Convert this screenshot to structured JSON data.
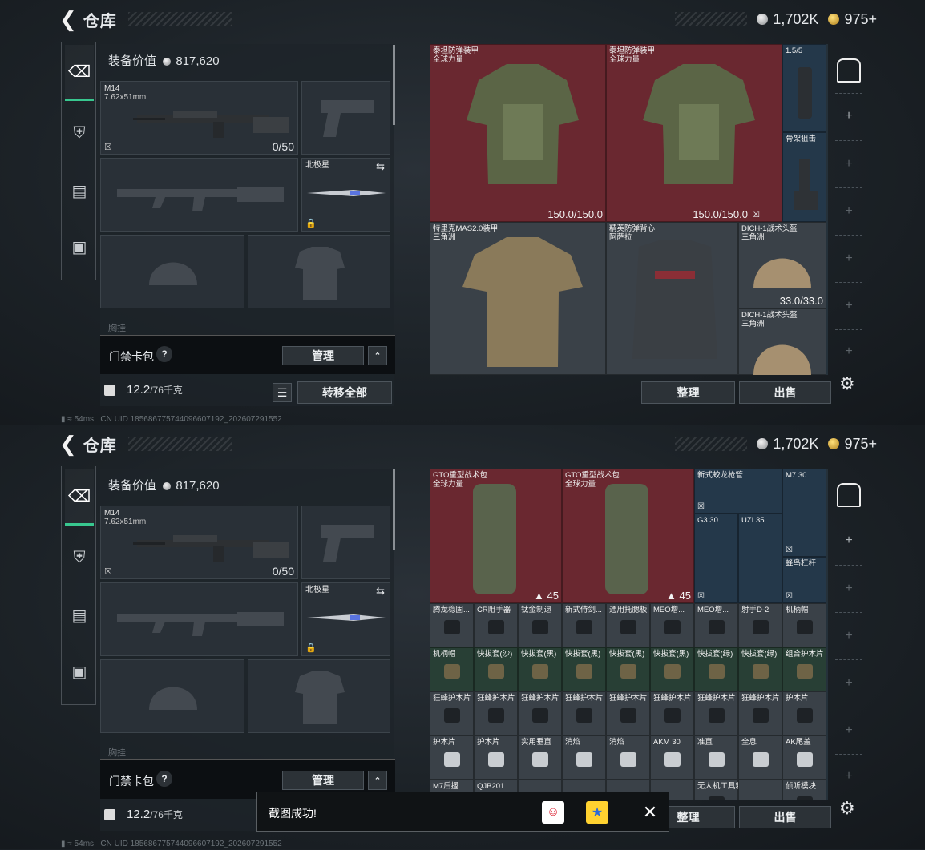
{
  "header": {
    "back_icon": "chevron-left-icon",
    "title": "仓库",
    "silver": "1,702K",
    "gold": "975+"
  },
  "status": {
    "ping": "54ms",
    "uid": "CN UID 185686775744096607192_202607291552"
  },
  "equipment": {
    "value_label": "装备价值",
    "value": "817,620",
    "primary": {
      "name": "M14",
      "caliber": "7.62x51mm",
      "ammo": "0/50"
    },
    "melee": {
      "name": "北极星"
    },
    "chest_label": "胸挂"
  },
  "keycase": {
    "label": "门禁卡包",
    "help": "?",
    "manage": "管理"
  },
  "weight": {
    "current": "12.2",
    "max": "/76千克",
    "transfer_all": "转移全部"
  },
  "actions": {
    "sort": "整理",
    "sell": "出售"
  },
  "stash_top": [
    {
      "name": "泰坦防弹装甲",
      "sub": "全球力量",
      "dur": "150.0/150.0"
    },
    {
      "name": "泰坦防弹装甲",
      "sub": "全球力量",
      "dur": "150.0/150.0"
    },
    {
      "name": "1.5/5",
      "sub": ""
    },
    {
      "name": "骨架狙击",
      "sub": ""
    },
    {
      "name": "特里克MAS2.0装甲",
      "sub": "三角洲"
    },
    {
      "name": "精英防弹背心",
      "sub": "阿萨拉"
    },
    {
      "name": "DICH-1战术头盔",
      "sub": "三角洲",
      "dur": "33.0/33.0"
    },
    {
      "name": "DICH-1战术头盔",
      "sub": "三角洲"
    }
  ],
  "stash_bot": {
    "packs": [
      {
        "name": "GTO重型战术包",
        "sub": "全球力量",
        "count": "45"
      },
      {
        "name": "GTO重型战术包",
        "sub": "全球力量",
        "count": "45"
      }
    ],
    "small": [
      "新式蛟龙枪管",
      "M7 30",
      "G3 30",
      "UZI 35",
      "蜂鸟杠杆"
    ],
    "row1": [
      "腾龙稳固...",
      "CR阻手器",
      "钛金制退",
      "新式侍剑...",
      "通用托腮板",
      "MEO增...",
      "MEO增...",
      "射手D-2",
      "机柄帽"
    ],
    "row2": [
      "机柄帽",
      "快拔套(沙)",
      "快拔套(黑)",
      "快拔套(黑)",
      "快拔套(黑)",
      "快拔套(黑)",
      "快拔套(绿)",
      "快拔套(绿)",
      "组合护木片"
    ],
    "row3": [
      "狂蜂护木片",
      "狂蜂护木片",
      "狂蜂护木片",
      "狂蜂护木片",
      "狂蜂护木片",
      "狂蜂护木片",
      "狂蜂护木片",
      "狂蜂护木片",
      "护木片"
    ],
    "row4": [
      "护木片",
      "护木片",
      "实用垂直",
      "消焰",
      "消焰",
      "AKM 30",
      "准直",
      "全息",
      "AK尾盖"
    ],
    "row5": [
      "M7后握",
      "QJB201",
      "",
      "",
      "",
      "",
      "无人机工具箱",
      "",
      "侦听模块"
    ]
  },
  "toast": {
    "message": "截图成功!"
  }
}
